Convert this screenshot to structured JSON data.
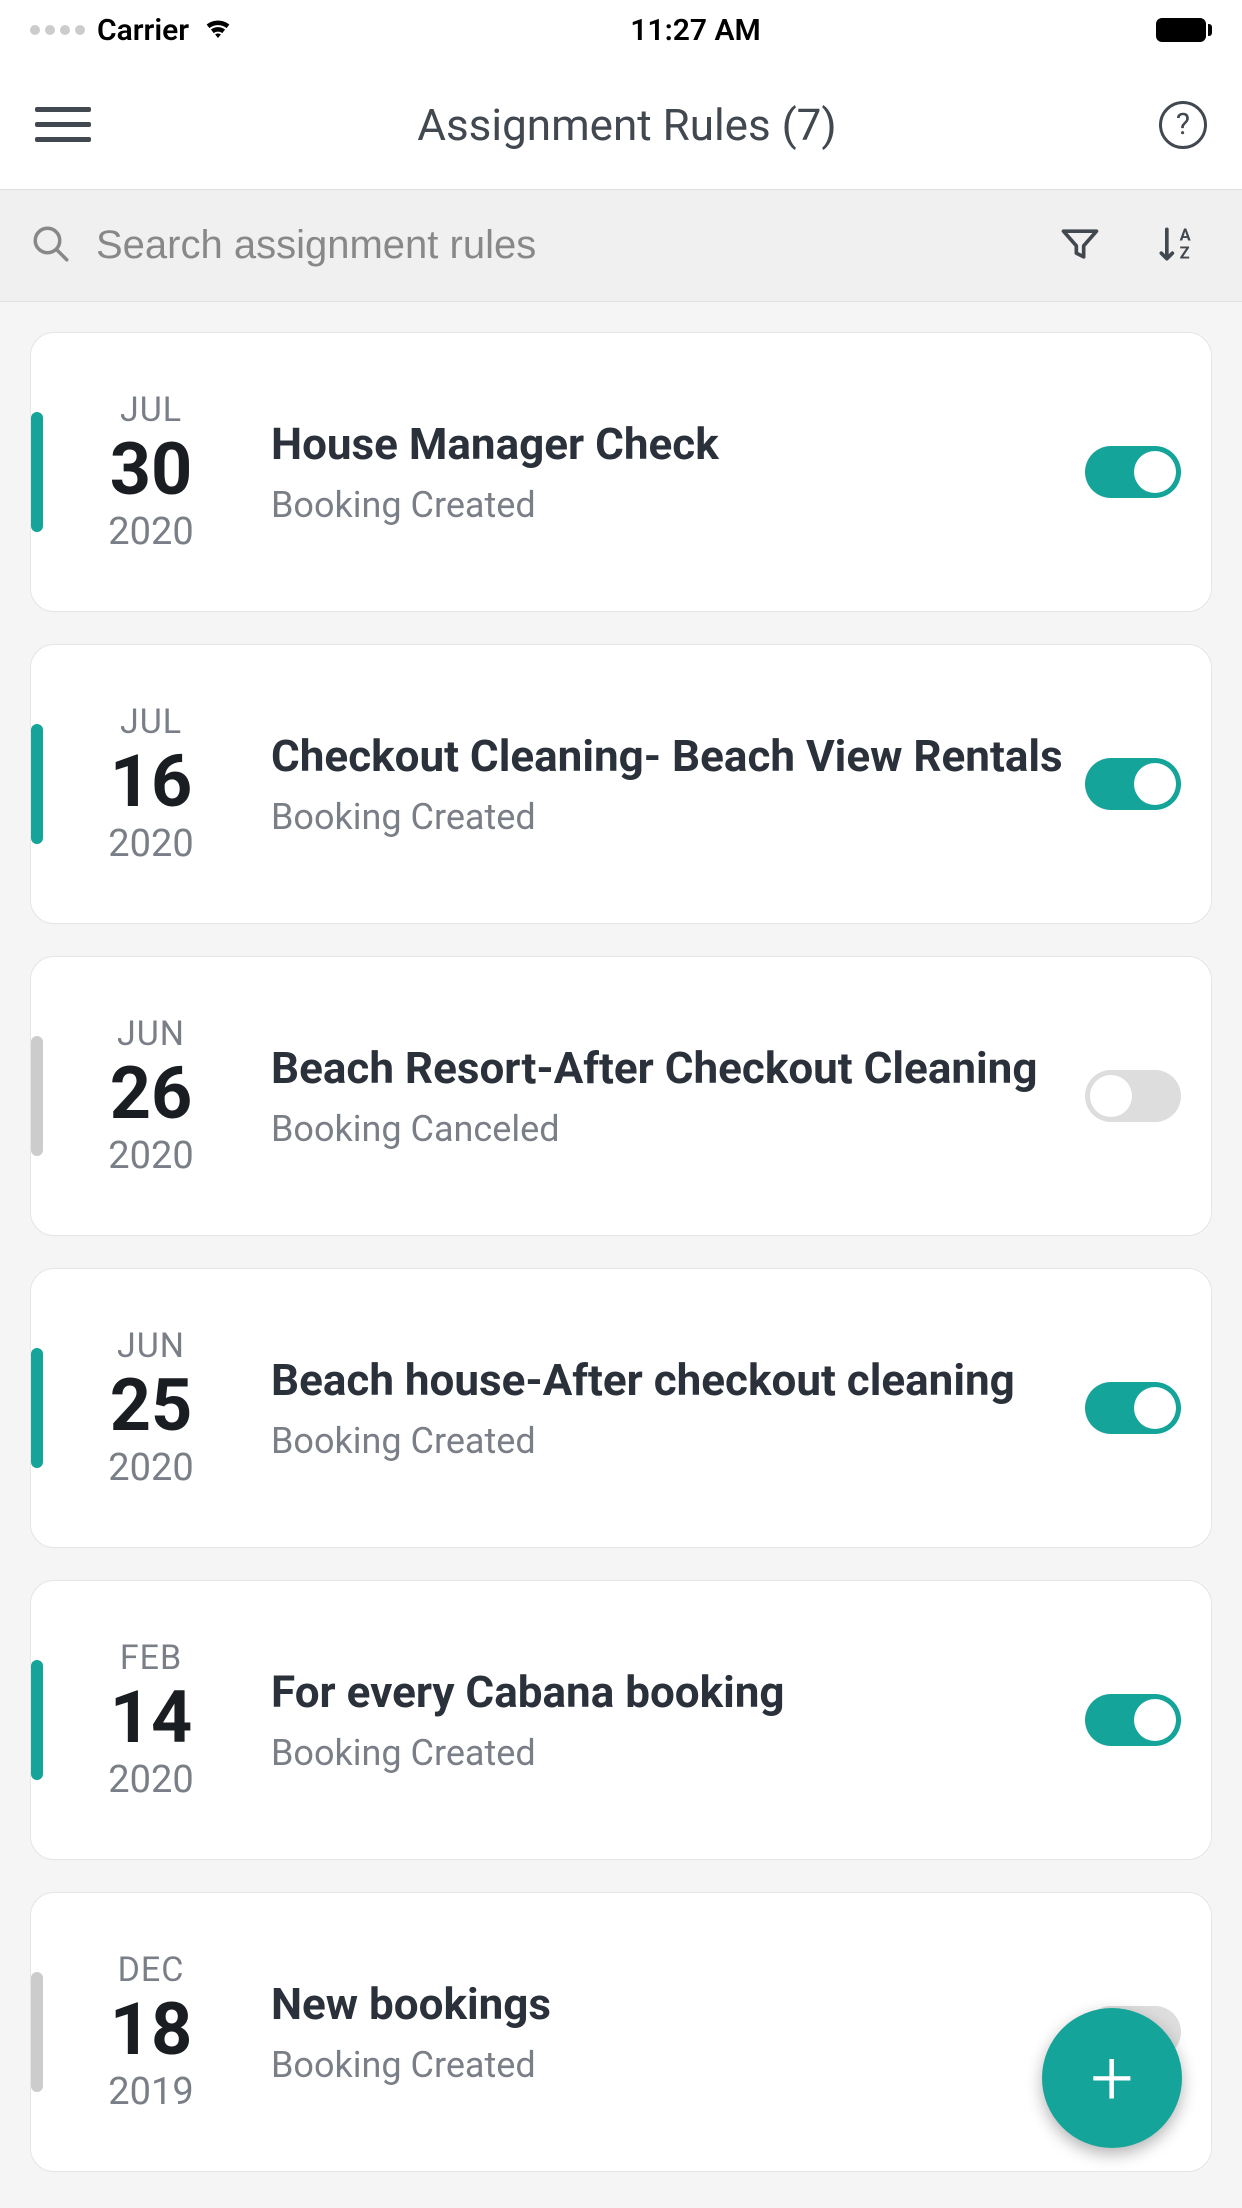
{
  "status_bar": {
    "carrier": "Carrier",
    "time": "11:27 AM"
  },
  "header": {
    "title": "Assignment Rules (7)"
  },
  "search": {
    "placeholder": "Search assignment rules"
  },
  "rules": [
    {
      "month": "JUL",
      "day": "30",
      "year": "2020",
      "title": "House Manager Check",
      "subtitle": "Booking Created",
      "enabled": true
    },
    {
      "month": "JUL",
      "day": "16",
      "year": "2020",
      "title": "Checkout Cleaning- Beach View Rentals",
      "subtitle": "Booking Created",
      "enabled": true
    },
    {
      "month": "JUN",
      "day": "26",
      "year": "2020",
      "title": "Beach Resort-After Checkout Cleaning",
      "subtitle": "Booking Canceled",
      "enabled": false
    },
    {
      "month": "JUN",
      "day": "25",
      "year": "2020",
      "title": "Beach house-After checkout cleaning",
      "subtitle": "Booking Created",
      "enabled": true
    },
    {
      "month": "FEB",
      "day": "14",
      "year": "2020",
      "title": "For every Cabana booking",
      "subtitle": "Booking Created",
      "enabled": true
    },
    {
      "month": "DEC",
      "day": "18",
      "year": "2019",
      "title": "New bookings",
      "subtitle": "Booking Created",
      "enabled": false
    }
  ]
}
